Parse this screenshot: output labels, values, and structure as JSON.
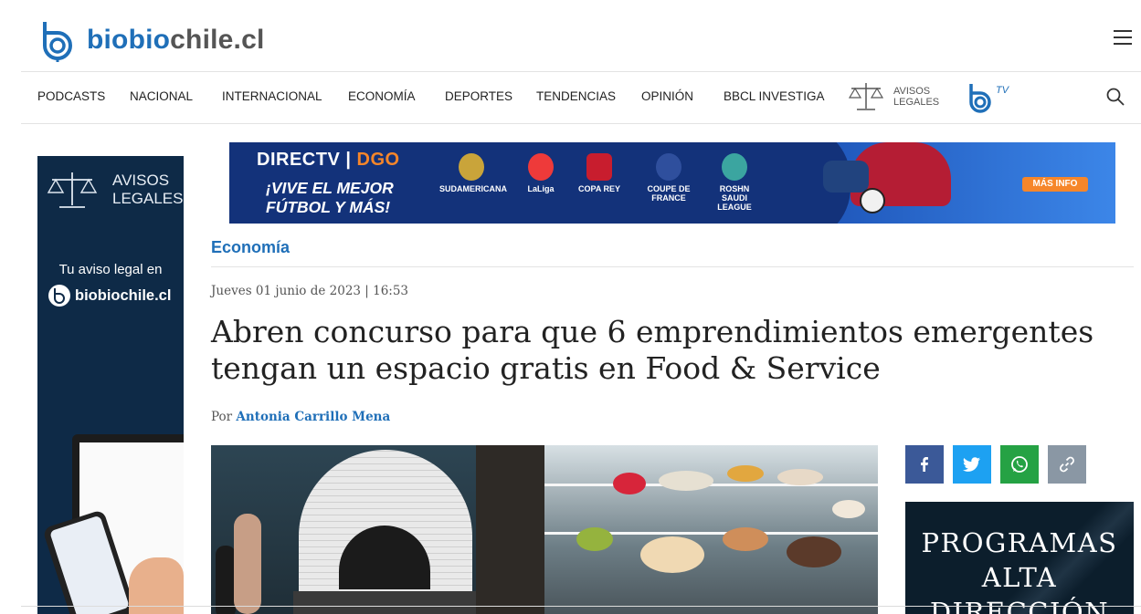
{
  "brand": {
    "name_part1": "biobio",
    "name_part2": "chile.cl",
    "color": "#1f6fb8"
  },
  "nav": {
    "items": [
      "PODCASTS",
      "NACIONAL",
      "INTERNACIONAL",
      "ECONOMÍA",
      "DEPORTES",
      "TENDENCIAS",
      "OPINIÓN",
      "BBCL INVESTIGA"
    ],
    "avisos_line1": "AVISOS",
    "avisos_line2": "LEGALES",
    "tv_label": "TV",
    "search_icon": "search-icon",
    "menu_icon": "hamburger-icon"
  },
  "left_ad": {
    "avisos_line1": "AVISOS",
    "avisos_line2": "LEGALES",
    "tagline": "Tu aviso legal en",
    "brand": "biobiochile.cl"
  },
  "banner": {
    "brand": "DIRECTV",
    "brand_go": "DGO",
    "slogan_line1": "¡VIVE EL MEJOR",
    "slogan_line2": "FÚTBOL Y MÁS!",
    "leagues": [
      "SUDAMERICANA",
      "LaLiga",
      "COPA REY",
      "COUPE DE FRANCE",
      "ROSHN SAUDI LEAGUE"
    ],
    "cta": "MÁS INFO",
    "accent": "#f6862a"
  },
  "article": {
    "category": "Economía",
    "date": "Jueves 01 junio de 2023 | 16:53",
    "title": "Abren concurso para que 6 emprendimientos emergentes tengan un espacio gratis en Food & Service",
    "by_prefix": "Por",
    "author": "Antonia Carrillo Mena"
  },
  "social": [
    {
      "name": "facebook",
      "color": "#3b5998"
    },
    {
      "name": "twitter",
      "color": "#1da1f2"
    },
    {
      "name": "whatsapp",
      "color": "#25a244"
    },
    {
      "name": "link",
      "color": "#8a97a4"
    }
  ],
  "promo": {
    "line1": "PROGRAMAS",
    "line2": "ALTA",
    "line3": "DIRECCIÓN"
  }
}
